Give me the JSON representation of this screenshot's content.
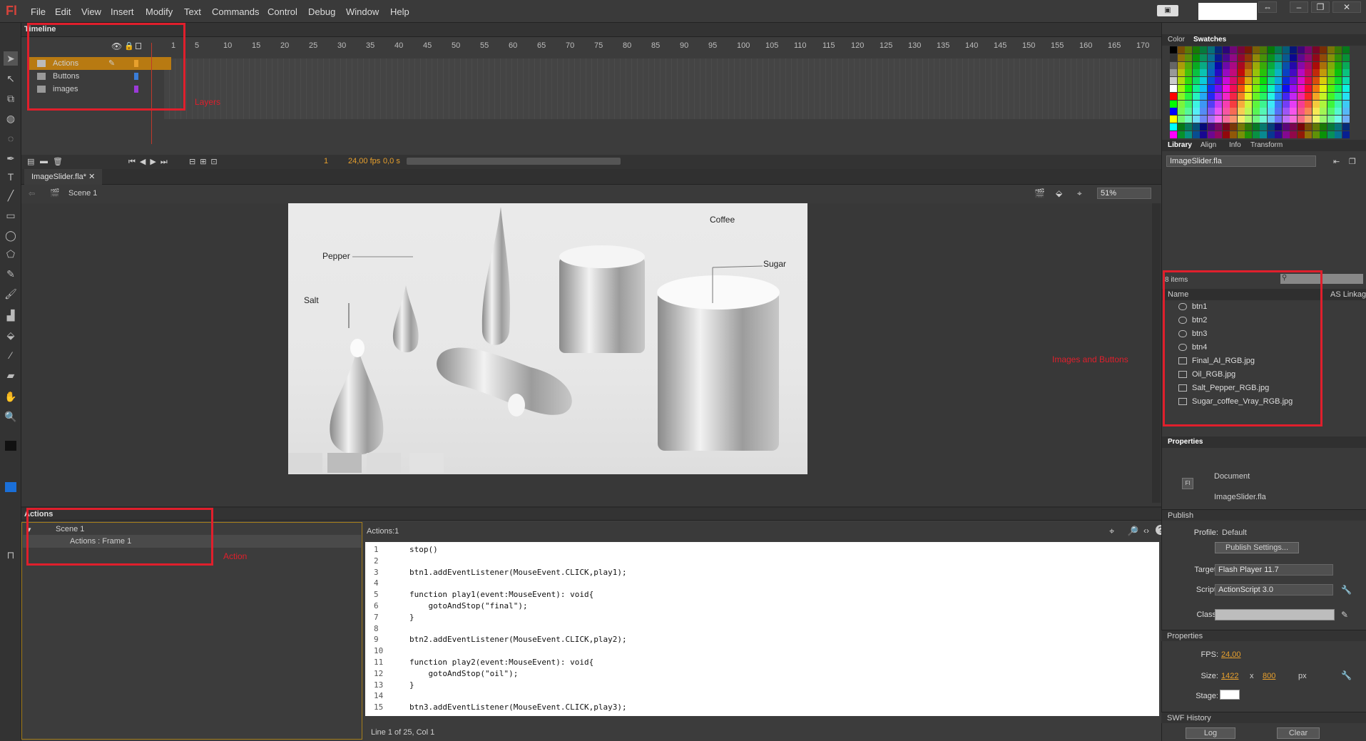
{
  "app": {
    "logo": "Fl"
  },
  "menu": [
    "File",
    "Edit",
    "View",
    "Insert",
    "Modify",
    "Text",
    "Commands",
    "Control",
    "Debug",
    "Window",
    "Help"
  ],
  "timeline": {
    "tab": "Timeline",
    "frame_numbers": [
      "1",
      "5",
      "10",
      "15",
      "20",
      "25",
      "30",
      "35",
      "40",
      "45",
      "50",
      "55",
      "60",
      "65",
      "70",
      "75",
      "80",
      "85",
      "90",
      "95",
      "100",
      "105",
      "110",
      "115",
      "120",
      "125",
      "130",
      "135",
      "140",
      "145",
      "150",
      "155",
      "160",
      "165",
      "170"
    ],
    "layers": [
      {
        "name": "Actions",
        "color": "#e8a02d",
        "selected": true
      },
      {
        "name": "Buttons",
        "color": "#3a7dd8",
        "selected": false
      },
      {
        "name": "images",
        "color": "#9b3ad8",
        "selected": false
      }
    ],
    "current_frame": "1",
    "fps": "24,00 fps",
    "elapsed": "0,0 s"
  },
  "document": {
    "tab": "ImageSlider.fla*",
    "scene": "Scene 1",
    "zoom": "51%"
  },
  "stage_labels": {
    "coffee": "Coffee",
    "pepper": "Pepper",
    "sugar": "Sugar",
    "salt": "Salt"
  },
  "annotations": {
    "layers": "Layers",
    "images_buttons": "Images and Buttons",
    "action": "Action"
  },
  "actions_panel": {
    "tab": "Actions",
    "tree_scene": "Scene 1",
    "tree_frame": "Actions : Frame 1",
    "script_tab": "Actions:1",
    "status": "Line 1 of 25, Col 1",
    "code": [
      {
        "n": "1",
        "t": "stop()"
      },
      {
        "n": "2",
        "t": ""
      },
      {
        "n": "3",
        "t": "btn1.addEventListener(MouseEvent.CLICK,play1);"
      },
      {
        "n": "4",
        "t": ""
      },
      {
        "n": "5",
        "t": "function play1(event:MouseEvent): void{"
      },
      {
        "n": "6",
        "t": "    gotoAndStop(\"final\");"
      },
      {
        "n": "7",
        "t": "}"
      },
      {
        "n": "8",
        "t": ""
      },
      {
        "n": "9",
        "t": "btn2.addEventListener(MouseEvent.CLICK,play2);"
      },
      {
        "n": "10",
        "t": ""
      },
      {
        "n": "11",
        "t": "function play2(event:MouseEvent): void{"
      },
      {
        "n": "12",
        "t": "    gotoAndStop(\"oil\");"
      },
      {
        "n": "13",
        "t": "}"
      },
      {
        "n": "14",
        "t": ""
      },
      {
        "n": "15",
        "t": "btn3.addEventListener(MouseEvent.CLICK,play3);"
      }
    ]
  },
  "color_panel": {
    "tabs": [
      "Color",
      "Swatches"
    ]
  },
  "library": {
    "tabs": [
      "Library",
      "Align",
      "Info",
      "Transform"
    ],
    "file": "ImageSlider.fla",
    "count": "8 items",
    "col_name": "Name",
    "col_linkage": "AS Linkag",
    "items": [
      {
        "name": "btn1",
        "kind": "button"
      },
      {
        "name": "btn2",
        "kind": "button"
      },
      {
        "name": "btn3",
        "kind": "button"
      },
      {
        "name": "btn4",
        "kind": "button"
      },
      {
        "name": "Final_AI_RGB.jpg",
        "kind": "bitmap"
      },
      {
        "name": "Oil_RGB.jpg",
        "kind": "bitmap"
      },
      {
        "name": "Salt_Pepper_RGB.jpg",
        "kind": "bitmap"
      },
      {
        "name": "Sugar_coffee_Vray_RGB.jpg",
        "kind": "bitmap"
      }
    ]
  },
  "properties": {
    "tab": "Properties",
    "doc_type": "Document",
    "doc_name": "ImageSlider.fla",
    "publish_header": "Publish",
    "profile_label": "Profile:",
    "profile_value": "Default",
    "publish_settings_btn": "Publish Settings...",
    "target_label": "Target:",
    "target_value": "Flash Player 11.7",
    "script_label": "Script:",
    "script_value": "ActionScript 3.0",
    "class_label": "Class:",
    "props_header": "Properties",
    "fps_label": "FPS:",
    "fps_value": "24,00",
    "size_label": "Size:",
    "width": "1422",
    "x": "x",
    "height": "800",
    "unit": "px",
    "stage_label": "Stage:",
    "swf_header": "SWF History",
    "log_btn": "Log",
    "clear_btn": "Clear"
  }
}
